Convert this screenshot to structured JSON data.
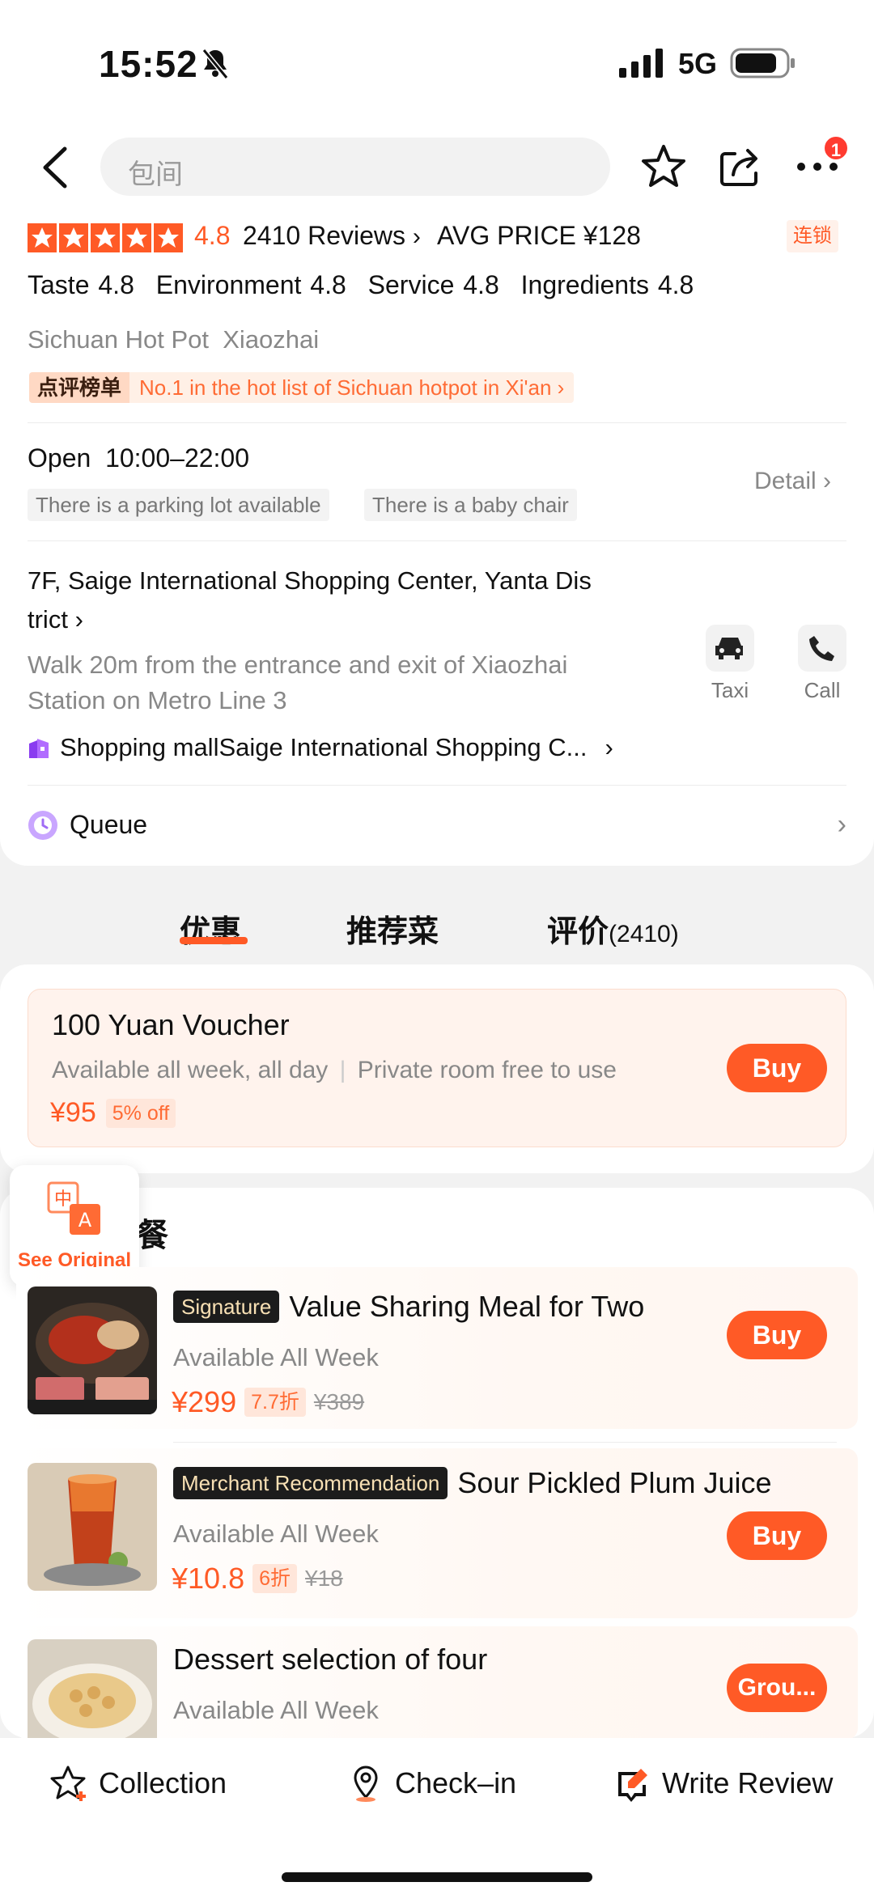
{
  "status": {
    "time": "15:52",
    "network": "5G"
  },
  "header": {
    "search_placeholder": "包间",
    "more_badge": "1"
  },
  "rating": {
    "score": "4.8",
    "stars": 5,
    "reviews": "2410 Reviews",
    "avg_price": "AVG PRICE ¥128",
    "chain_tag": "连锁"
  },
  "scores": [
    "Taste 4.8",
    "Environment 4.8",
    "Service 4.8",
    "Ingredients 4.8"
  ],
  "category": "Sichuan Hot Pot  Xiaozhai",
  "rank": {
    "tag": "点评榜单",
    "text": "No.1 in the hot list of Sichuan hotpot in Xi'an"
  },
  "hours": {
    "label": "Open  10:00–22:00",
    "facilities": [
      "There is a parking lot available",
      "There is a baby chair"
    ],
    "detail": "Detail"
  },
  "address": {
    "line1": "7F, Saige International Shopping Center, Yanta Dis",
    "line2": "trict",
    "walk1": "Walk 20m from the entrance and exit of Xiaozhai",
    "walk2": "Station on Metro Line 3",
    "taxi": "Taxi",
    "call": "Call"
  },
  "mall": {
    "prefix": "Shopping mall",
    "name": "Saige International Shopping C..."
  },
  "queue": "Queue",
  "tabs": [
    {
      "label": "优惠"
    },
    {
      "label": "推荐菜"
    },
    {
      "label": "评价",
      "count": "(2410)"
    }
  ],
  "voucher": {
    "title": "100 Yuan Voucher",
    "sub1": "Available all week, all day",
    "sub2": "Private room free to use",
    "price": "¥95",
    "discount": "5% off",
    "buy": "Buy"
  },
  "translate": {
    "label": "See Original"
  },
  "section_title": "餐",
  "items": [
    {
      "badge": "Signature",
      "title": "Value Sharing Meal for Two",
      "sub": "Available All Week",
      "price": "¥299",
      "discount": "7.7折",
      "original": "¥389",
      "button": "Buy"
    },
    {
      "badge": "Merchant Recommendation",
      "title": "Sour Pickled Plum Juice",
      "sub": "Available All Week",
      "price": "¥10.8",
      "discount": "6折",
      "original": "¥18",
      "button": "Buy"
    },
    {
      "badge": "",
      "title": "Dessert selection of four",
      "sub": "Available All Week",
      "button": "Grou..."
    }
  ],
  "bottom_bar": {
    "collection": "Collection",
    "checkin": "Check–in",
    "review": "Write Review"
  },
  "colors": {
    "accent": "#ff5a26",
    "tag_bg": "#fff0e6"
  }
}
